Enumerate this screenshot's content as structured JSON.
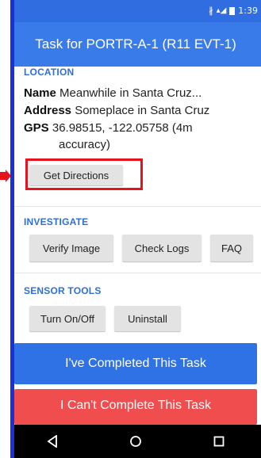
{
  "status_bar": {
    "time": "1:39"
  },
  "title_bar": {
    "title": "Task for PORTR-A-1 (R11 EVT-1)"
  },
  "location": {
    "heading": "LOCATION",
    "name_label": "Name",
    "name_value": "Meanwhile in Santa Cruz...",
    "address_label": "Address",
    "address_value": "Someplace in Santa Cruz",
    "gps_label": "GPS",
    "gps_value": "36.98515, -122.05758 (4m",
    "gps_accuracy": "accuracy)",
    "directions_button": "Get Directions"
  },
  "investigate": {
    "heading": "INVESTIGATE",
    "buttons": [
      "Verify Image",
      "Check Logs",
      "FAQ"
    ]
  },
  "sensor_tools": {
    "heading": "SENSOR TOOLS",
    "buttons": [
      "Turn On/Off",
      "Uninstall"
    ]
  },
  "actions": {
    "completed": "I've Completed This Task",
    "cant_complete": "I Can't Complete This Task"
  },
  "colors": {
    "app_bar": "#3a7bea",
    "accent": "#2d6fd9",
    "completed_button": "#2f72e6",
    "cant_complete_button": "#f04e4e",
    "highlight": "#e8121e"
  },
  "icons": {
    "status": [
      "bluetooth-icon",
      "signal-icon",
      "battery-icon"
    ],
    "nav": [
      "back-icon",
      "home-icon",
      "recents-icon"
    ]
  }
}
